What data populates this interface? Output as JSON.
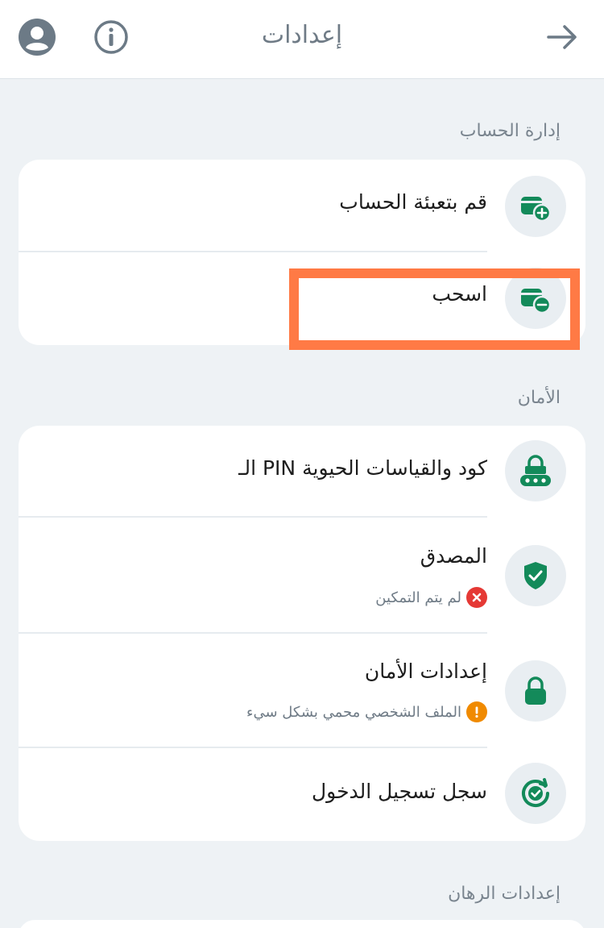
{
  "header": {
    "title": "إعدادات",
    "avatar_icon": "user-avatar-icon",
    "info_icon": "info-icon",
    "back_icon": "arrow-right-icon"
  },
  "account_section": {
    "label": "إدارة الحساب",
    "items": [
      {
        "label": "قم بتعبئة الحساب",
        "icon": "wallet-plus-icon"
      },
      {
        "label": "اسحب",
        "icon": "wallet-minus-icon",
        "highlighted": true
      }
    ]
  },
  "security_section": {
    "label": "الأمان",
    "items": [
      {
        "label": "كود والقياسات الحيوية PIN الـ",
        "icon": "pin-lock-icon"
      },
      {
        "label": "المصدق",
        "icon": "shield-check-icon",
        "status": "لم يتم التمكين",
        "status_icon": "error-x-icon"
      },
      {
        "label": "إعدادات الأمان",
        "icon": "lock-icon",
        "status": "الملف الشخصي محمي بشكل سيء",
        "status_icon": "warning-icon"
      },
      {
        "label": "سجل تسجيل الدخول",
        "icon": "history-check-icon"
      }
    ]
  },
  "betting_section": {
    "label": "إعدادات الرهان"
  },
  "colors": {
    "accent_green": "#138a5a",
    "badge_bg": "#e9eef2",
    "error_red": "#e53935",
    "warning_orange": "#f08a00",
    "highlight_orange": "#ff7a45"
  }
}
